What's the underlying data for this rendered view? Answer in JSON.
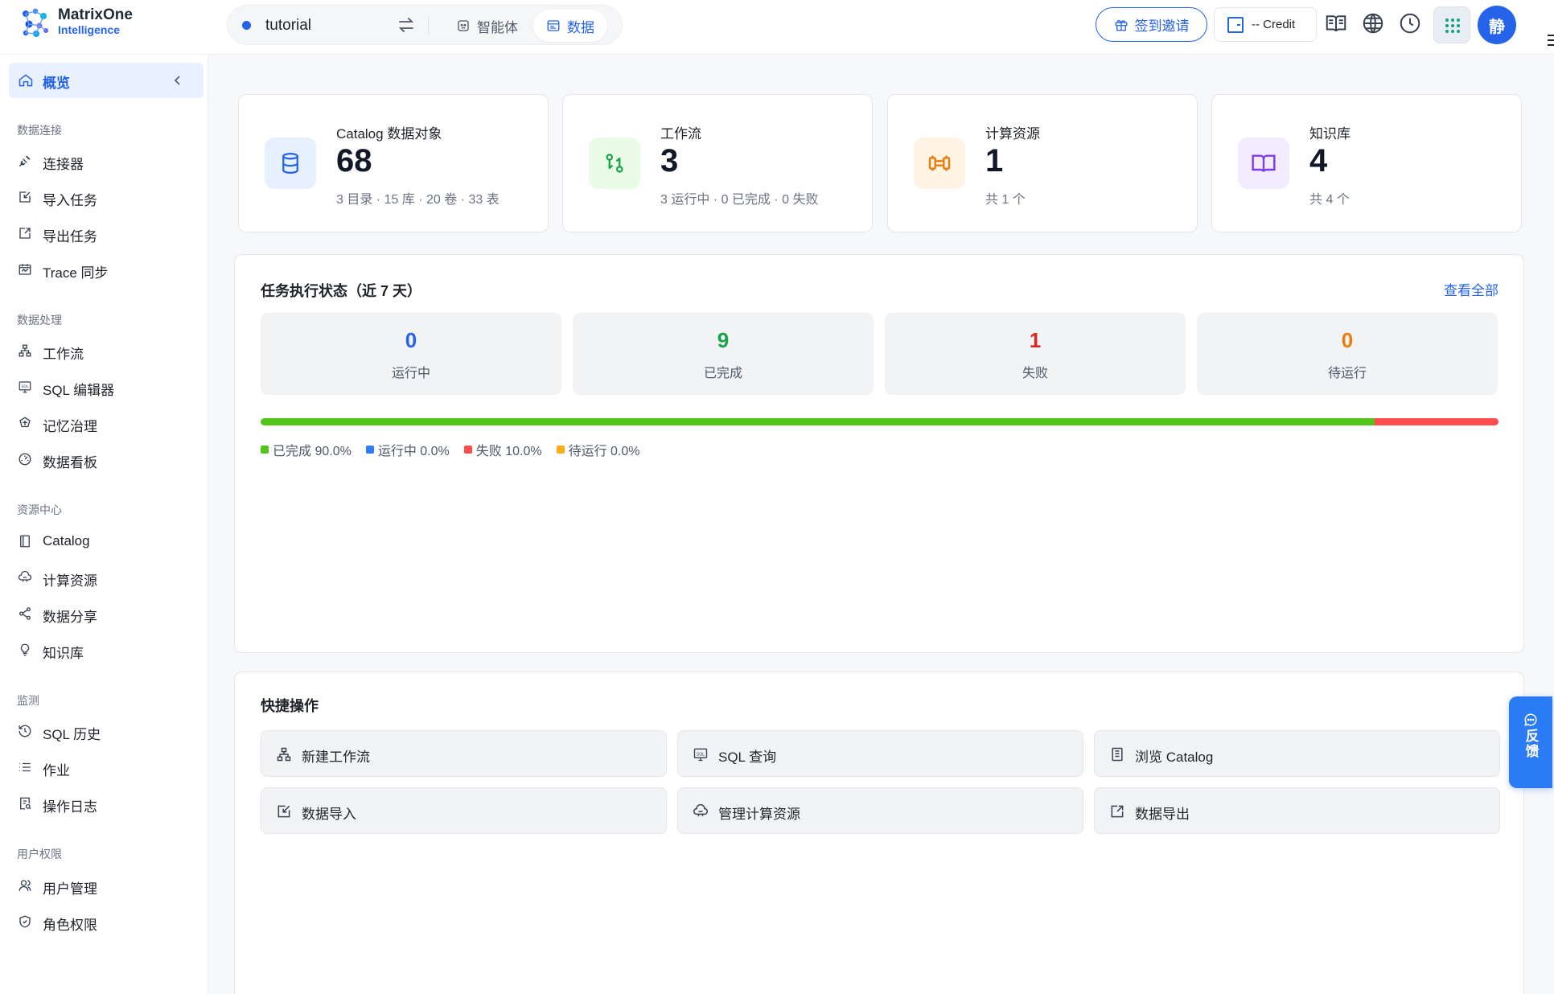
{
  "brand": {
    "name_line1": "MatrixOne",
    "name_line2": "Intelligence",
    "color": "#2563eb"
  },
  "header": {
    "context_name": "tutorial",
    "tabs": [
      {
        "label": "智能体",
        "active": false
      },
      {
        "label": "数据",
        "active": true
      }
    ],
    "invite_label": "签到邀请",
    "credit_label": "-- Credit",
    "avatar_text": "静"
  },
  "sidebar": {
    "overview_label": "概览",
    "groups": [
      {
        "title": "数据连接",
        "items": [
          {
            "label": "连接器",
            "icon": "plug-icon"
          },
          {
            "label": "导入任务",
            "icon": "import-icon"
          },
          {
            "label": "导出任务",
            "icon": "export-icon"
          },
          {
            "label": "Trace 同步",
            "icon": "trace-icon"
          }
        ]
      },
      {
        "title": "数据处理",
        "items": [
          {
            "label": "工作流",
            "icon": "workflow-icon"
          },
          {
            "label": "SQL 编辑器",
            "icon": "sql-icon"
          },
          {
            "label": "记忆治理",
            "icon": "memory-icon"
          },
          {
            "label": "数据看板",
            "icon": "dashboard-icon"
          }
        ]
      },
      {
        "title": "资源中心",
        "items": [
          {
            "label": "Catalog",
            "icon": "catalog-icon"
          },
          {
            "label": "计算资源",
            "icon": "compute-icon"
          },
          {
            "label": "数据分享",
            "icon": "share-icon"
          },
          {
            "label": "知识库",
            "icon": "bulb-icon"
          }
        ]
      },
      {
        "title": "监测",
        "items": [
          {
            "label": "SQL 历史",
            "icon": "history-icon"
          },
          {
            "label": "作业",
            "icon": "list-icon"
          },
          {
            "label": "操作日志",
            "icon": "log-icon"
          }
        ]
      },
      {
        "title": "用户权限",
        "items": [
          {
            "label": "用户管理",
            "icon": "users-icon"
          },
          {
            "label": "角色权限",
            "icon": "shield-icon"
          }
        ]
      }
    ]
  },
  "stats": [
    {
      "label": "Catalog 数据对象",
      "value": "68",
      "sub": "3 目录 · 15 库 · 20 卷 · 33 表",
      "icon": "database-icon",
      "color": "#2563eb"
    },
    {
      "label": "工作流",
      "value": "3",
      "sub": "3 运行中 · 0 已完成 · 0 失败",
      "icon": "workflow-icon",
      "color": "#16a34a"
    },
    {
      "label": "计算资源",
      "value": "1",
      "sub": "共 1 个",
      "icon": "compute-icon",
      "color": "#ea7b0c"
    },
    {
      "label": "知识库",
      "value": "4",
      "sub": "共 4 个",
      "icon": "book-icon",
      "color": "#7c3aed"
    }
  ],
  "task_status": {
    "title": "任务执行状态（近 7 天）",
    "view_all": "查看全部",
    "boxes": [
      {
        "value": "0",
        "label": "运行中",
        "color": "#2563eb"
      },
      {
        "value": "9",
        "label": "已完成",
        "color": "#16a34a"
      },
      {
        "value": "1",
        "label": "失败",
        "color": "#dc2626"
      },
      {
        "value": "0",
        "label": "待运行",
        "color": "#ea7b0c"
      }
    ],
    "progress": [
      {
        "label": "已完成",
        "fraction": 0.9,
        "color": "#52c41a"
      },
      {
        "label": "运行中",
        "fraction": 0.0,
        "color": "#2f7cf6"
      },
      {
        "label": "失败",
        "fraction": 0.1,
        "color": "#ff4d4f"
      },
      {
        "label": "待运行",
        "fraction": 0.0,
        "color": "#faad14"
      }
    ],
    "legend": [
      {
        "text": "已完成 90.0%",
        "color": "#52c41a"
      },
      {
        "text": "运行中 0.0%",
        "color": "#2f7cf6"
      },
      {
        "text": "失败 10.0%",
        "color": "#ff4d4f"
      },
      {
        "text": "待运行 0.0%",
        "color": "#faad14"
      }
    ]
  },
  "quick_actions": {
    "title": "快捷操作",
    "items": [
      {
        "label": "新建工作流",
        "icon": "workflow-icon"
      },
      {
        "label": "SQL 查询",
        "icon": "sql-icon"
      },
      {
        "label": "浏览 Catalog",
        "icon": "catalog-icon"
      },
      {
        "label": "数据导入",
        "icon": "import-icon"
      },
      {
        "label": "管理计算资源",
        "icon": "compute-icon"
      },
      {
        "label": "数据导出",
        "icon": "export-icon"
      }
    ]
  },
  "feedback_label": "反馈"
}
